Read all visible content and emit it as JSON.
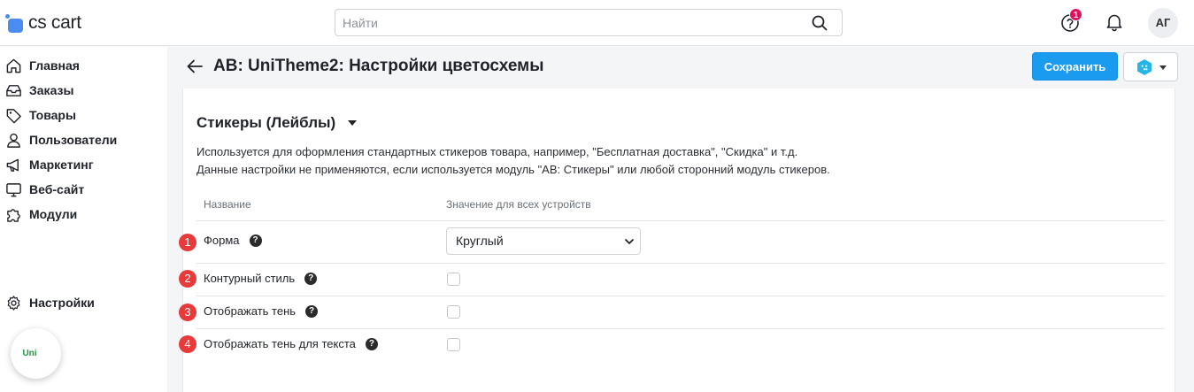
{
  "header": {
    "logo_text": "cs cart",
    "search_placeholder": "Найти",
    "notification_count": "1",
    "avatar_initials": "АГ"
  },
  "sidebar": {
    "items": [
      {
        "label": "Главная",
        "icon": "home-icon"
      },
      {
        "label": "Заказы",
        "icon": "inbox-icon"
      },
      {
        "label": "Товары",
        "icon": "tag-icon"
      },
      {
        "label": "Пользователи",
        "icon": "user-icon"
      },
      {
        "label": "Маркетинг",
        "icon": "megaphone-icon"
      },
      {
        "label": "Веб-сайт",
        "icon": "monitor-icon"
      },
      {
        "label": "Модули",
        "icon": "puzzle-icon"
      }
    ],
    "settings_label": "Настройки",
    "uni_label": "Uni"
  },
  "page": {
    "title": "AB: UniTheme2: Настройки цветосхемы",
    "save_label": "Сохранить"
  },
  "section": {
    "title": "Стикеры (Лейблы)",
    "description_1": "Используется для оформления стандартных стикеров товара, например, \"Бесплатная доставка\", \"Скидка\" и т.д.",
    "description_2": "Данные настройки не применяются, если используется модуль \"AB: Стикеры\" или любой сторонний модуль стикеров.",
    "columns": {
      "name": "Название",
      "value": "Значение для всех устройств"
    },
    "rows": [
      {
        "num": "1",
        "label": "Форма",
        "type": "select",
        "value": "Круглый"
      },
      {
        "num": "2",
        "label": "Контурный стиль",
        "type": "checkbox",
        "checked": false
      },
      {
        "num": "3",
        "label": "Отображать тень",
        "type": "checkbox",
        "checked": false
      },
      {
        "num": "4",
        "label": "Отображать тень для текста",
        "type": "checkbox",
        "checked": false
      }
    ]
  },
  "colors": {
    "accent": "#1a9bf0",
    "badge": "#e0115f",
    "marker": "#e83a3a",
    "logo": "#4a8cf0"
  }
}
